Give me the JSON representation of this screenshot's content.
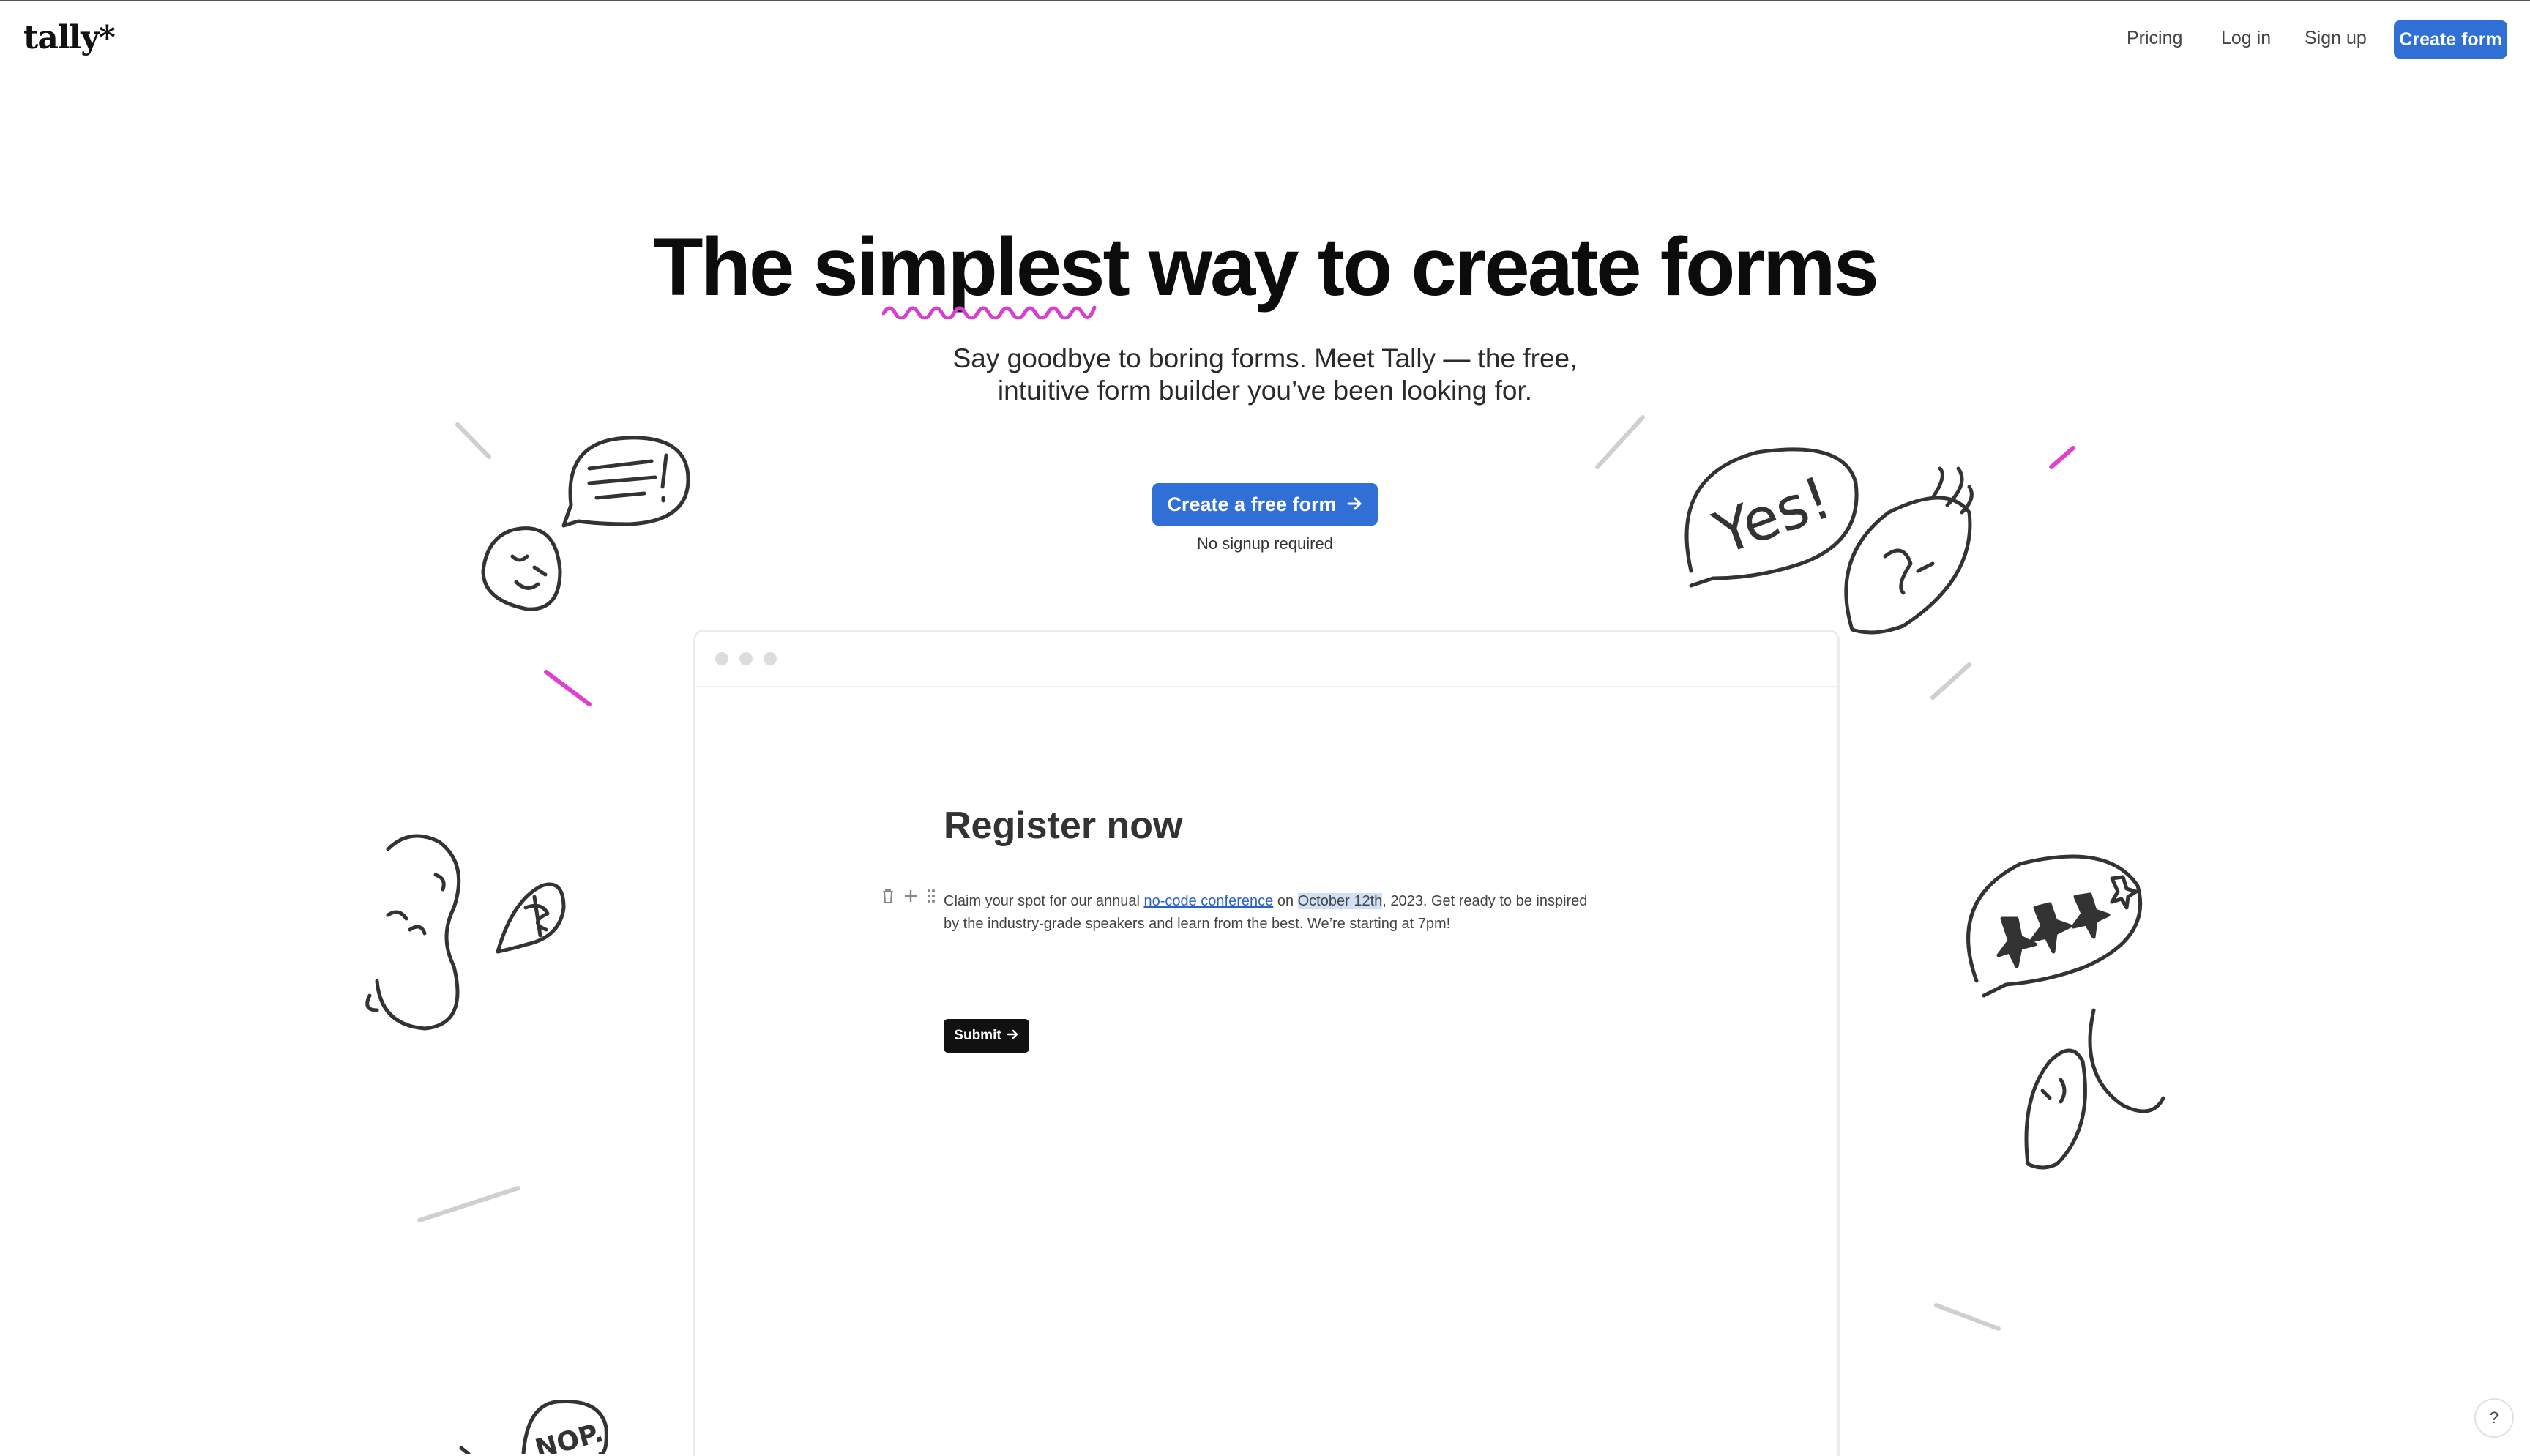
{
  "header": {
    "logo": "tally*",
    "nav": {
      "pricing": "Pricing",
      "login": "Log in",
      "signup": "Sign up",
      "create": "Create form"
    }
  },
  "hero": {
    "headline": "The simplest way to create forms",
    "subtitle_line1": "Say goodbye to boring forms. Meet Tally — the free,",
    "subtitle_line2": "intuitive form builder you’ve been looking for.",
    "cta_label": "Create a free form",
    "cta_note": "No signup required"
  },
  "demo_form": {
    "title": "Register now",
    "text_before_link": "Claim your spot for our annual ",
    "link_text": "no-code conference",
    "text_on": " on ",
    "highlight_text": "October 12th",
    "text_after": ", 2023. Get ready to be inspired by the industry-grade speakers and learn from the best. We’re starting at 7pm!",
    "submit_label": "Submit"
  },
  "help_label": "?",
  "doodle_text": {
    "yes_bubble": "Yes!",
    "nope_bubble": "NOP."
  },
  "colors": {
    "accent_blue": "#2f6fd6",
    "highlight_pink": "#e040d0",
    "doodle_gray": "#cfcfcf"
  }
}
